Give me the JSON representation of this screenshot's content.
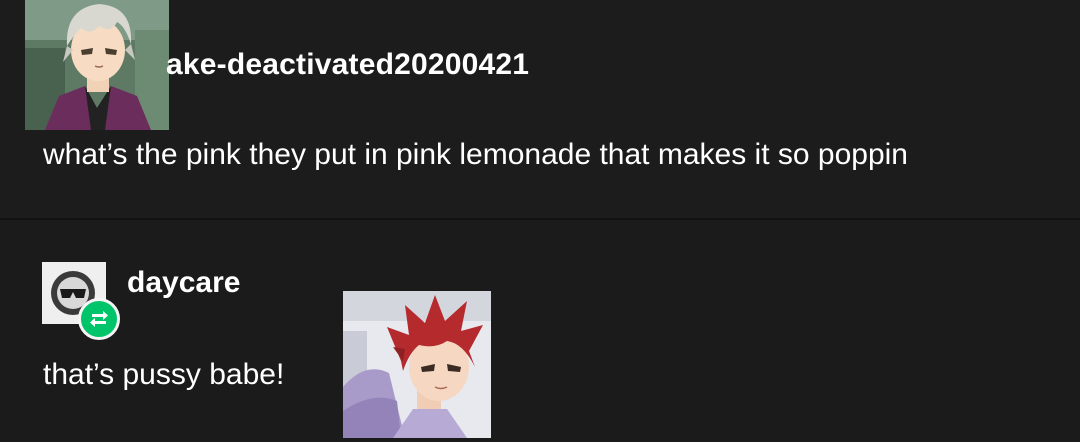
{
  "posts": [
    {
      "username": "ake-deactivated20200421",
      "text": "what’s the pink they put in pink lemonade that makes it so poppin",
      "avatar_icon": "anime-character-avatar"
    },
    {
      "username": "daycare",
      "text": "that’s pussy babe!",
      "avatar_icon": "sunglasses-face-avatar",
      "badge_icon": "reblog-icon",
      "image_icon": "anime-character-image"
    }
  ],
  "colors": {
    "background": "#1c1c1c",
    "text": "#ffffff",
    "reblog_badge": "#00c46a"
  }
}
